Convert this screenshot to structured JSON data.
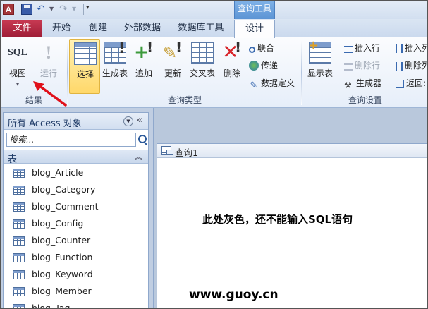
{
  "titlebar": {
    "app_icon_letter": "A",
    "context_group": "查询工具"
  },
  "tabs": {
    "file": "文件",
    "items": [
      "开始",
      "创建",
      "外部数据",
      "数据库工具",
      "设计"
    ],
    "active": "设计"
  },
  "ribbon": {
    "results_group": {
      "label": "结果",
      "view": "视图",
      "run": "运行",
      "view_icon_text": "SQL",
      "run_icon_text": "!"
    },
    "query_type_group": {
      "label": "查询类型",
      "buttons": [
        "选择",
        "生成表",
        "追加",
        "更新",
        "交叉表",
        "删除"
      ],
      "small_buttons": [
        "联合",
        "传递",
        "数据定义"
      ]
    },
    "query_setup_group": {
      "label": "查询设置",
      "show_table": "显示表",
      "small_col1": [
        "插入行",
        "删除行",
        "生成器"
      ],
      "small_col2": [
        "插入列",
        "删除列",
        "返回:"
      ]
    }
  },
  "nav_pane": {
    "title": "所有 Access 对象",
    "search_placeholder": "搜索...",
    "section": "表",
    "items": [
      "blog_Article",
      "blog_Category",
      "blog_Comment",
      "blog_Config",
      "blog_Counter",
      "blog_Function",
      "blog_Keyword",
      "blog_Member",
      "blog_Tag"
    ]
  },
  "document": {
    "tab_label": "查询1",
    "annotation": "此处灰色，还不能输入SQL语句"
  },
  "watermark": "www.guoy.cn",
  "colors": {
    "file_tab": "#b52a44",
    "context_group": "#6ba3de",
    "arrow": "#e0101a",
    "selected_button": "#ffd86a"
  }
}
